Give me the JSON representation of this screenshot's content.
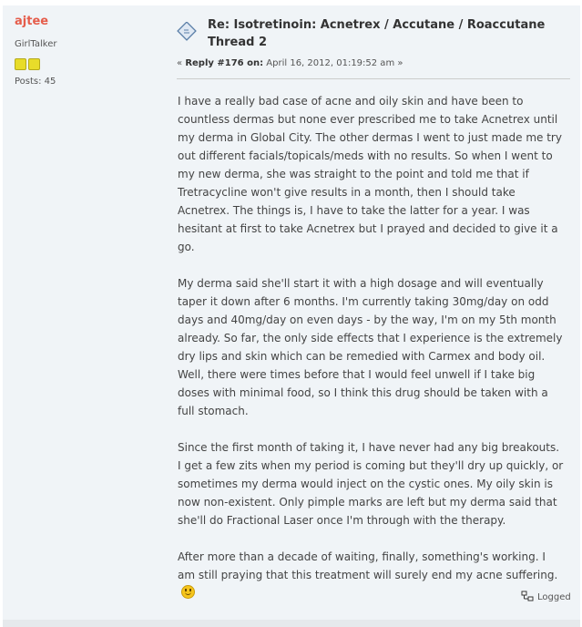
{
  "poster": {
    "name": "ajtee",
    "group": "GirlTalker",
    "star_count": 2,
    "posts": "Posts: 45"
  },
  "post": {
    "title_line1": "Re: Isotretinoin: Acnetrex / Accutane / Roaccutane",
    "title_line2": "Thread 2",
    "reply_open": "«",
    "reply_label": "Reply #176 on:",
    "reply_date": "April 16, 2012, 01:19:52 am",
    "reply_close": "»",
    "paragraphs": [
      "I have a really bad case of acne and oily skin and have been to countless dermas but none ever prescribed me to take Acnetrex until my derma in Global City. The other dermas I went to just made me try out different facials/topicals/meds with no results. So when I went to my new derma, she was straight to the point and told me that if Tretracycline won't give results in a month, then I should take Acnetrex. The things is, I have to take the latter for a year. I was hesitant at first to take Acnetrex but I prayed and decided to give it a go.",
      "My derma said she'll start it with a high dosage and will eventually taper it down after 6 months. I'm currently taking 30mg/day on odd days and 40mg/day on even days - by the way, I'm on my 5th month already. So far, the only side effects that I experience is the extremely dry lips and skin which can be remedied with Carmex and body oil. Well, there were times before that I would feel unwell if I take big doses with minimal food, so I think this drug should be taken with a full stomach.",
      "Since the first month of taking it, I have never had any big breakouts. I get a few zits when my period is coming but they'll dry up quickly, or sometimes my derma would inject on the cystic ones. My oily skin is now non-existent. Only pimple marks are left but my derma said that she'll do Fractional Laser once I'm through with the therapy.",
      "After more than a decade of waiting, finally, something's working. I am still praying that this treatment will surely end my acne suffering."
    ],
    "logged_label": "Logged"
  },
  "icons": {
    "post_icon": "message-icon",
    "smiley": "smiley-icon",
    "logged": "ip-logged-icon"
  },
  "colors": {
    "poster_name": "#e55d4b",
    "post_background": "#f0f4f7",
    "star": "#e8dc2a"
  }
}
